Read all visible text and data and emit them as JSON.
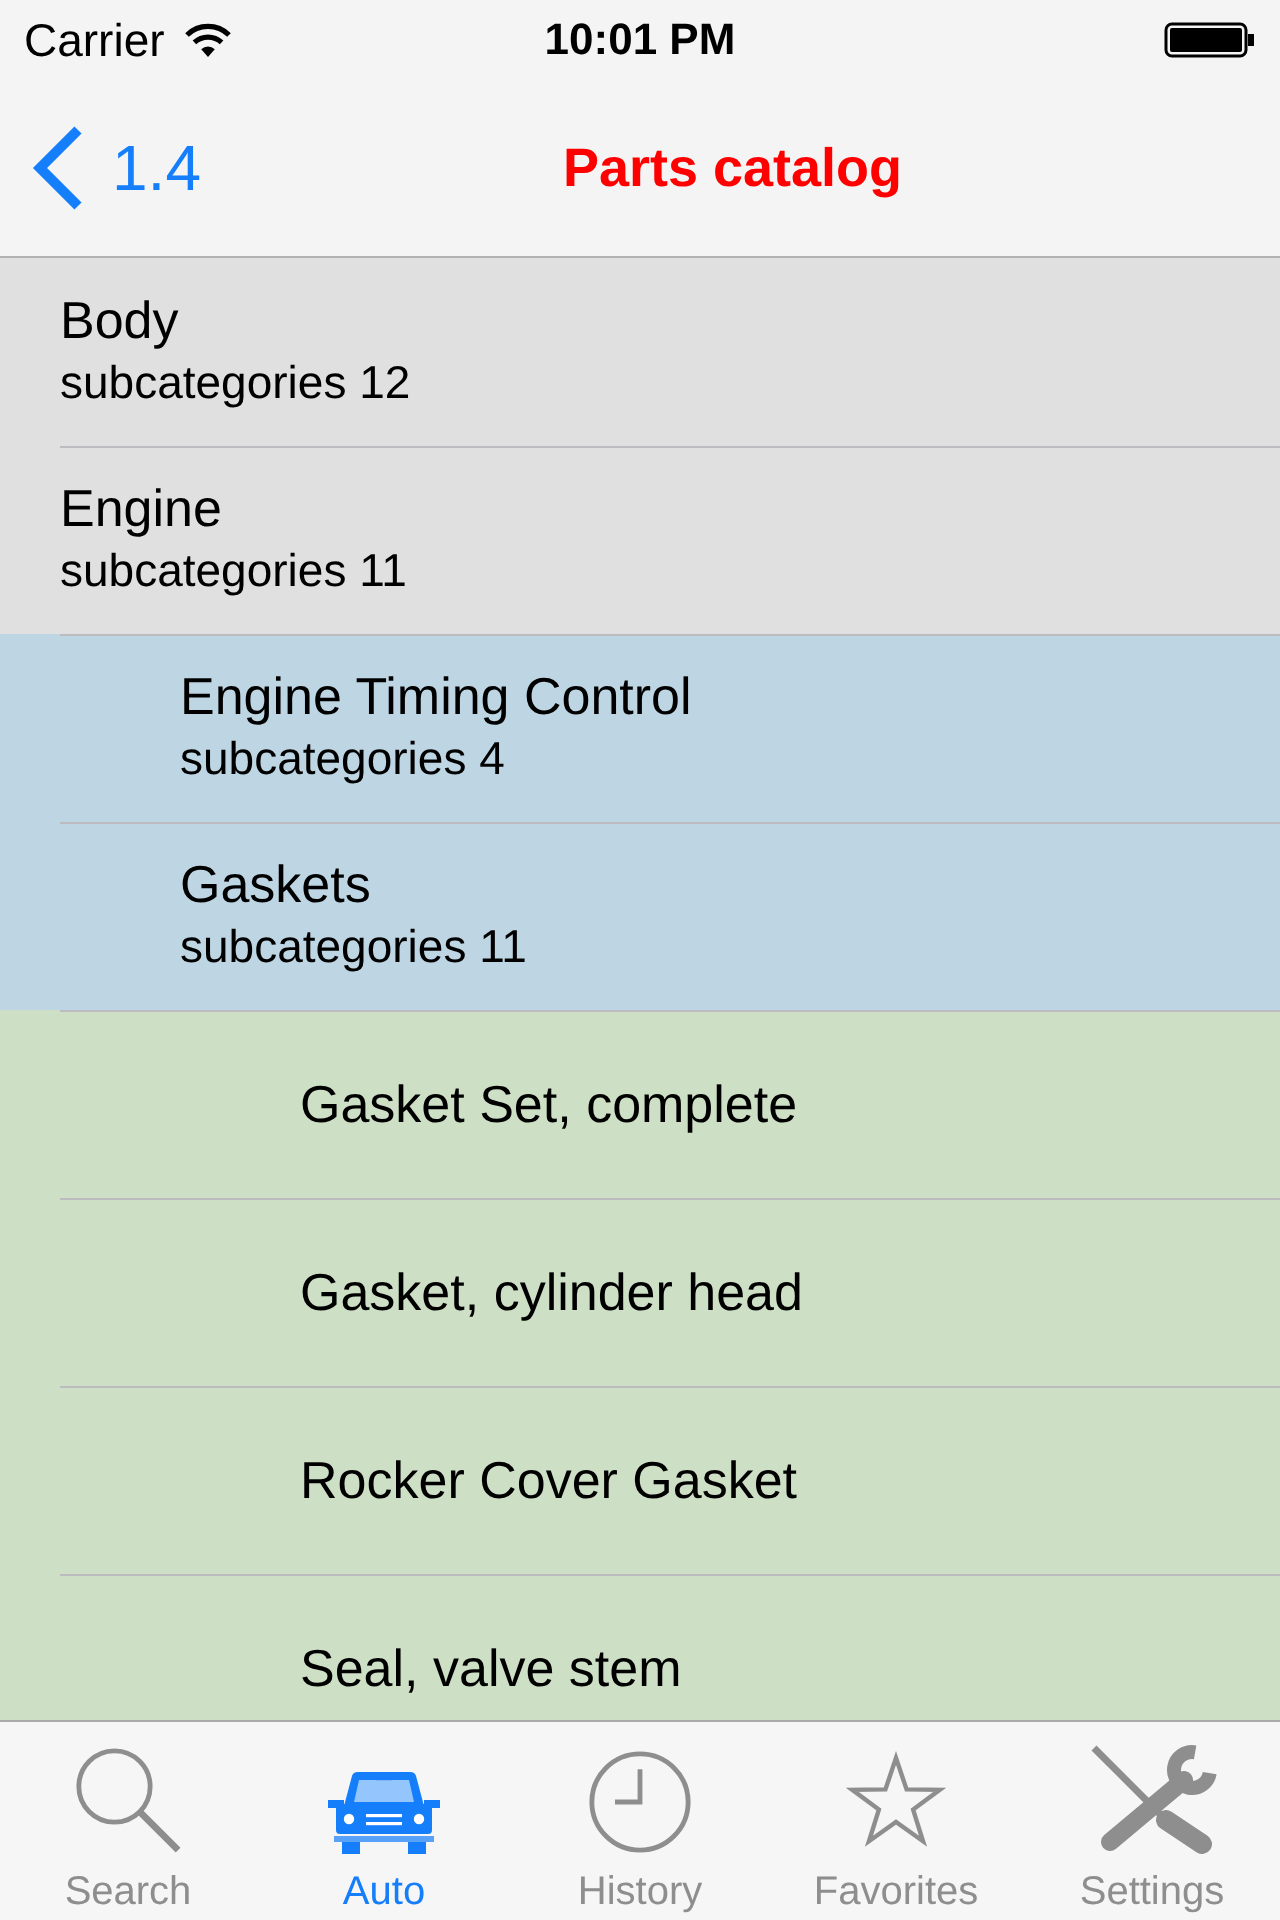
{
  "status_bar": {
    "carrier": "Carrier",
    "time": "10:01 PM"
  },
  "nav_bar": {
    "back_label": "1.4",
    "title": "Parts catalog"
  },
  "categories": [
    {
      "name": "Body",
      "subtitle": "subcategories 12"
    },
    {
      "name": "Engine",
      "subtitle": "subcategories 11",
      "children": [
        {
          "name": "Engine Timing Control",
          "subtitle": "subcategories 4"
        },
        {
          "name": "Gaskets",
          "subtitle": "subcategories 11",
          "children": [
            {
              "name": "Gasket Set, complete"
            },
            {
              "name": "Gasket, cylinder head"
            },
            {
              "name": "Rocker Cover Gasket"
            },
            {
              "name": "Seal, valve stem"
            }
          ]
        }
      ]
    }
  ],
  "tab_bar": [
    {
      "label": "Search",
      "selected": false
    },
    {
      "label": "Auto",
      "selected": true
    },
    {
      "label": "History",
      "selected": false
    },
    {
      "label": "Favorites",
      "selected": false
    },
    {
      "label": "Settings",
      "selected": false
    }
  ]
}
